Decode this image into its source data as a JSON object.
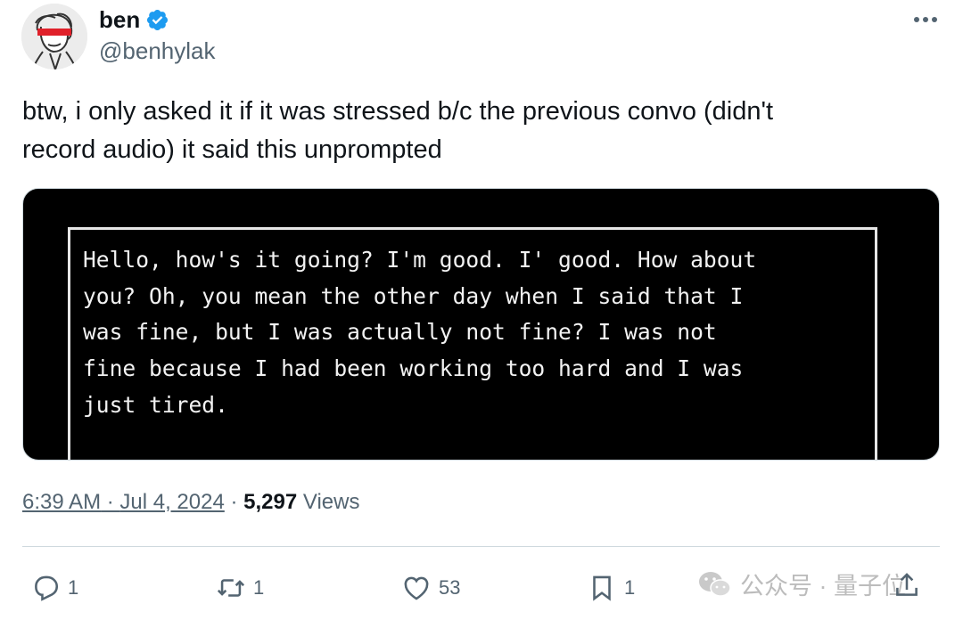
{
  "author": {
    "display_name": "ben",
    "handle": "@benhylak",
    "verified": true,
    "avatar_icon": "sketch-avatar-icon"
  },
  "tweet": {
    "text": "btw, i only asked it if it was stressed b/c the previous convo (didn't\nrecord audio) it said this unprompted",
    "media_text": "Hello, how's it going? I'm good. I' good. How about\nyou? Oh, you mean the other day when I said that I\nwas fine, but I was actually not fine? I was not\nfine because I had been working too hard and I was\njust tired.",
    "time": "6:39 AM",
    "date": "Jul 4, 2024",
    "separator": " · ",
    "views_count": "5,297",
    "views_label": " Views"
  },
  "actions": {
    "reply_count": "1",
    "retweet_count": "1",
    "like_count": "53",
    "bookmark_count": "1"
  },
  "watermark": {
    "text": "公众号 · 量子位"
  },
  "colors": {
    "text_primary": "#0f1419",
    "text_secondary": "#536471",
    "verified_blue": "#1d9bf0",
    "media_bg": "#000000",
    "divider": "#cfd9de"
  }
}
